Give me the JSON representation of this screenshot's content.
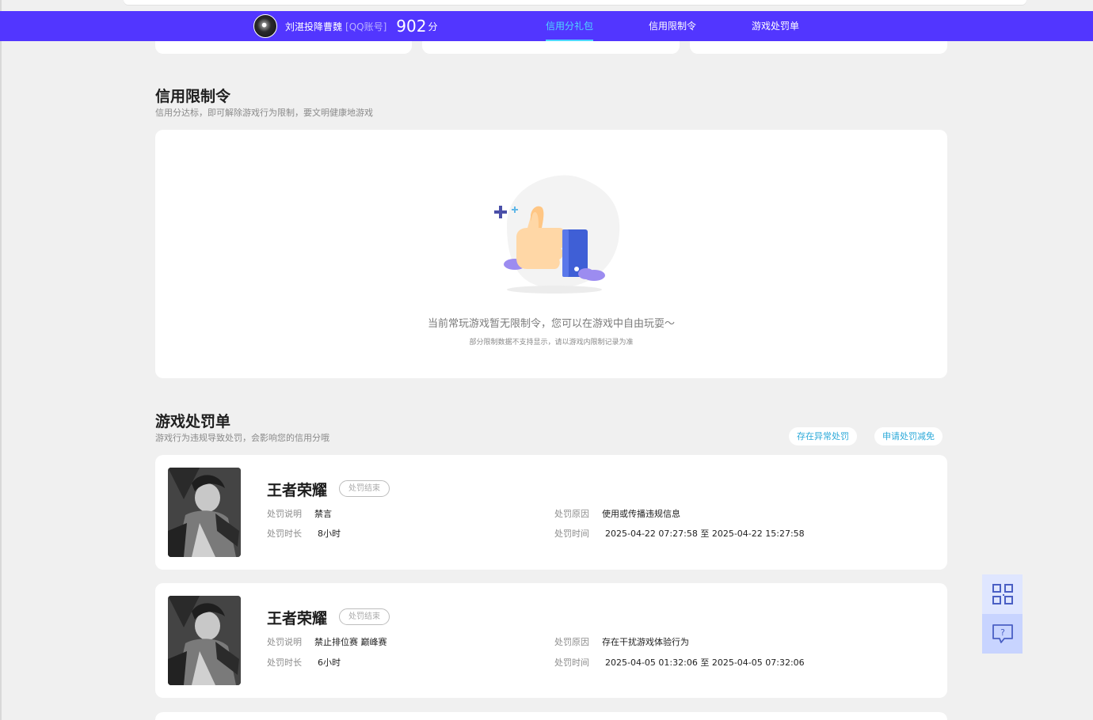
{
  "header": {
    "user_name": "刘湛投降曹魏",
    "user_tag": "[QQ账号]",
    "score": "902",
    "score_unit": "分",
    "nav": [
      {
        "label": "信用分礼包",
        "active": true
      },
      {
        "label": "信用限制令",
        "active": false
      },
      {
        "label": "游戏处罚单",
        "active": false
      }
    ],
    "brand_color": "#5236ff",
    "active_color": "#4fd8ff"
  },
  "restriction": {
    "title": "信用限制令",
    "subtitle": "信用分达标，即可解除游戏行为限制，要文明健康地游戏",
    "empty_main": "当前常玩游戏暂无限制令，您可以在游戏中自由玩耍～",
    "empty_sub": "部分限制数据不支持显示，请以游戏内限制记录为准",
    "illustration_icon": "thumbs-up-icon"
  },
  "punishment": {
    "title": "游戏处罚单",
    "subtitle": "游戏行为违规导致处罚，会影响您的信用分哦",
    "buttons": {
      "abnormal": "存在异常处罚",
      "reduce": "申请处罚减免"
    },
    "labels": {
      "desc": "处罚说明",
      "duration": "处罚时长",
      "reason": "处罚原因",
      "time": "处罚时间"
    },
    "items": [
      {
        "game": "王者荣耀",
        "status": "处罚结束",
        "desc": "禁言",
        "duration": "8小时",
        "reason": "使用或传播违规信息",
        "time": "2025-04-22 07:27:58 至 2025-04-22 15:27:58"
      },
      {
        "game": "王者荣耀",
        "status": "处罚结束",
        "desc": "禁止排位赛 巅峰赛",
        "duration": "6小时",
        "reason": "存在干扰游戏体验行为",
        "time": "2025-04-05 01:32:06 至 2025-04-05 07:32:06"
      }
    ]
  },
  "float": {
    "qr_icon": "qr-code-icon",
    "help_icon": "help-chat-icon"
  }
}
